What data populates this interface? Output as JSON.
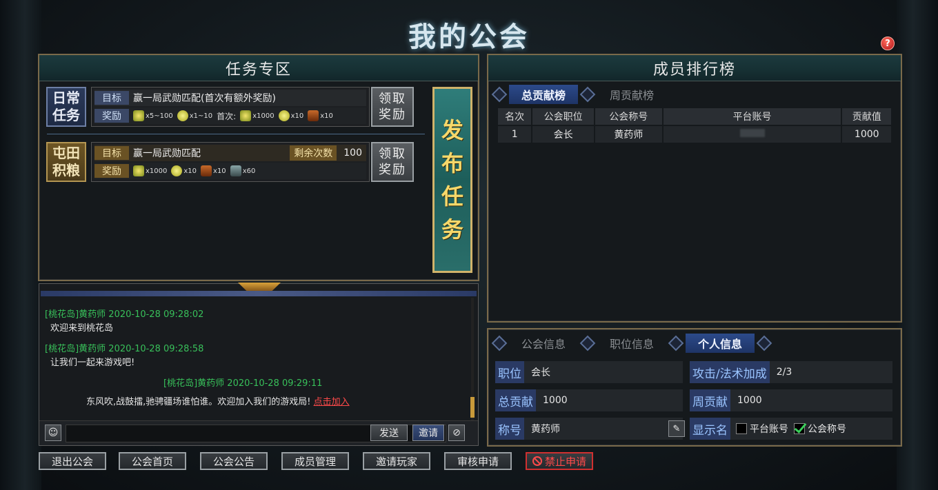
{
  "window": {
    "title": "我的公会",
    "help": "?"
  },
  "task_panel": {
    "title": "任务专区",
    "tasks": [
      {
        "tag_line1": "日常",
        "tag_line2": "任务",
        "goal_label": "目标",
        "goal_text": "赢一局武勋匹配(首次有额外奖励)",
        "reward_label": "奖励",
        "rewards": [
          "x5~100",
          "x1~10"
        ],
        "first_time_label": "首次:",
        "first_rewards": [
          "x1000",
          "x10",
          "x10"
        ],
        "claim_line1": "领取",
        "claim_line2": "奖励"
      },
      {
        "tag_line1": "屯田",
        "tag_line2": "积粮",
        "goal_label": "目标",
        "goal_text": "赢一局武勋匹配",
        "remain_label": "剩余次数",
        "remain_value": "100",
        "reward_label": "奖励",
        "rewards": [
          "x1000",
          "x10",
          "x10",
          "x60"
        ],
        "claim_line1": "领取",
        "claim_line2": "奖励"
      }
    ],
    "publish_button": [
      "发",
      "布",
      "任",
      "务"
    ]
  },
  "chat": {
    "messages": [
      {
        "name": "[桃花岛]黄药师",
        "time": "2020-10-28 09:28:02",
        "text": "欢迎来到桃花岛"
      },
      {
        "name": "[桃花岛]黄药师",
        "time": "2020-10-28 09:28:58",
        "text": "让我们一起来游戏吧!"
      },
      {
        "name": "[桃花岛]黄药师",
        "time": "2020-10-28 09:29:11",
        "text": "东风吹,战鼓擂,驰骋疆场谁怕谁。欢迎加入我们的游戏局!",
        "link": "点击加入"
      }
    ],
    "input_value": "",
    "send_label": "发送",
    "invite_label": "邀请",
    "block_symbol": "⊘",
    "emote_symbol": "☺"
  },
  "ranking": {
    "title": "成员排行榜",
    "tabs": [
      "总贡献榜",
      "周贡献榜"
    ],
    "columns": [
      "名次",
      "公会职位",
      "公会称号",
      "平台账号",
      "贡献值"
    ],
    "rows": [
      {
        "rank": "1",
        "position": "会长",
        "title": "黄药师",
        "account": "",
        "contribution": "1000"
      }
    ]
  },
  "info": {
    "tabs": [
      "公会信息",
      "职位信息",
      "个人信息"
    ],
    "position_label": "职位",
    "position_value": "会长",
    "bonus_label": "攻击/法术加成",
    "bonus_value": "2/3",
    "total_label": "总贡献",
    "total_value": "1000",
    "weekly_label": "周贡献",
    "weekly_value": "1000",
    "nickname_label": "称号",
    "nickname_value": "黄药师",
    "display_label": "显示名",
    "display_options": [
      {
        "label": "平台账号",
        "checked": false
      },
      {
        "label": "公会称号",
        "checked": true
      }
    ]
  },
  "bottom_buttons": [
    "退出公会",
    "公会首页",
    "公会公告",
    "成员管理",
    "邀请玩家",
    "审核申请",
    "禁止申请"
  ],
  "colors": {
    "accent_gold": "#d0b36a",
    "panel_head": "#1c3a3e",
    "tab_active": "#2c4a8a",
    "danger": "#ff4a4a",
    "chat_name": "#38c05a"
  }
}
